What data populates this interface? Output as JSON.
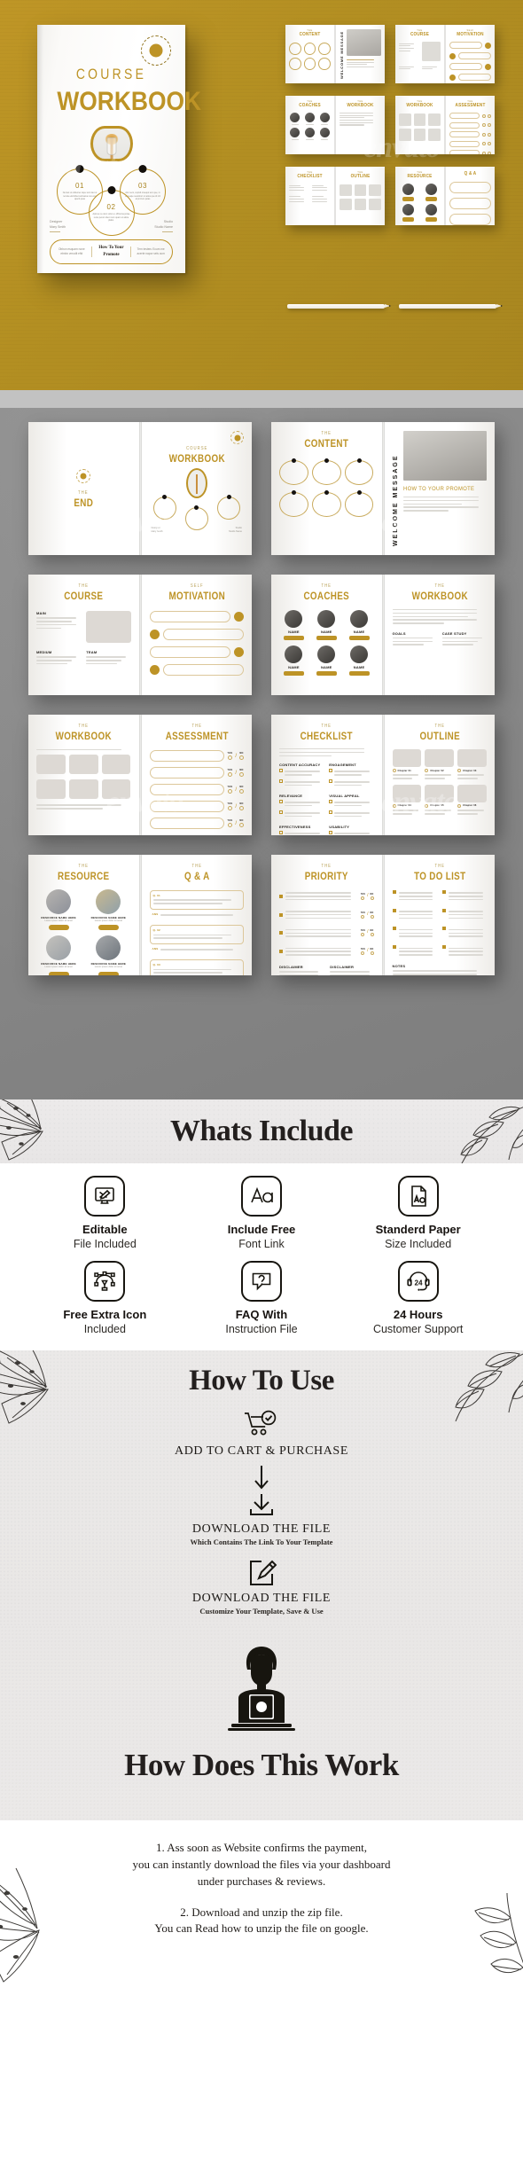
{
  "hero": {
    "cover": {
      "badge_icon": "seal-badge-icon",
      "eyebrow": "COURSE",
      "title": "WORKBOOK",
      "circles": [
        {
          "num": "01",
          "text": "Ne laut ut odituores rape sum laut ut remote elicinibet subnama non-sinc aperit quas"
        },
        {
          "num": "02",
          "text": "Apid es ce dem solut et, officuma porae recte perum ident cum quam ut adice plabo."
        },
        {
          "num": "03",
          "text": "Atur sent, cupistl onsequi tem que, in Aeceape nessitrum ut atius que id mil at prorum quias"
        }
      ],
      "meta_left_label": "Designer",
      "meta_left_value": "Mary Smith",
      "meta_right_label": "Studio",
      "meta_right_value": "Studio Name",
      "bar_left": "Obbon esquam none etmbx vmodit efid",
      "bar_mid": "How To Your Promote",
      "bar_right": "Tem testeru Ecum me acerte napor sels cum"
    },
    "watermark": "envato",
    "thumbnails": [
      {
        "left_sup": "THE",
        "left_title": "CONTENT",
        "right_sup": "",
        "right_title": "WELCOME MESSAGE",
        "kind": "content"
      },
      {
        "left_sup": "THE",
        "left_title": "COURSE",
        "right_sup": "SELF",
        "right_title": "MOTIVATION",
        "kind": "course"
      },
      {
        "left_sup": "THE",
        "left_title": "COACHES",
        "right_sup": "THE",
        "right_title": "WORKBOOK",
        "kind": "coaches"
      },
      {
        "left_sup": "THE",
        "left_title": "WORKBOOK",
        "right_sup": "THE",
        "right_title": "ASSESSMENT",
        "kind": "workbook"
      },
      {
        "left_sup": "THE",
        "left_title": "CHECKLIST",
        "right_sup": "THE",
        "right_title": "OUTLINE",
        "kind": "checklist"
      },
      {
        "left_sup": "THE",
        "left_title": "RESOURCE",
        "right_sup": "",
        "right_title": "Q & A",
        "kind": "resource"
      }
    ],
    "pencil_icon": "pencil-icon"
  },
  "spreads": [
    {
      "left_sup": "THE",
      "left_title": "END",
      "right_sup": "COURSE",
      "right_title": "WORKBOOK",
      "kind": "end-cover"
    },
    {
      "left_sup": "THE",
      "left_title": "CONTENT",
      "right_sup": "",
      "right_title": "WELCOME MESSAGE",
      "right_sub": "HOW TO YOUR PROMOTE",
      "kind": "content"
    },
    {
      "left_sup": "THE",
      "left_title": "COURSE",
      "right_sup": "SELF",
      "right_title": "MOTIVATION",
      "kind": "course"
    },
    {
      "left_sup": "THE",
      "left_title": "COACHES",
      "right_sup": "THE",
      "right_title": "WORKBOOK",
      "kind": "coaches"
    },
    {
      "left_sup": "THE",
      "left_title": "WORKBOOK",
      "right_sup": "THE",
      "right_title": "ASSESSMENT",
      "kind": "workbook"
    },
    {
      "left_sup": "THE",
      "left_title": "CHECKLIST",
      "right_sup": "THE",
      "right_title": "OUTLINE",
      "kind": "checklist"
    },
    {
      "left_sup": "THE",
      "left_title": "RESOURCE",
      "right_sup": "THE",
      "right_title": "Q & A",
      "kind": "resource"
    },
    {
      "left_sup": "THE",
      "left_title": "PRIORITY",
      "right_sup": "THE",
      "right_title": "TO DO LIST",
      "kind": "priority"
    }
  ],
  "checklist_labels": {
    "a": "CONTENT ACCURACY",
    "b": "ENGAGEMENT",
    "c": "RELEVANCE",
    "d": "VISUAL APPEAL",
    "e": "EFFECTIVENESS",
    "f": "USABILITY"
  },
  "priority_labels": {
    "disclaimer": "DISCLAIMER",
    "notes": "NOTES"
  },
  "assessment_answer": {
    "yes": "YES",
    "no": "NO"
  },
  "whats_include": {
    "heading": "Whats Include",
    "floral_left_icon": "lily-flower-icon",
    "floral_right_icon": "leaf-branch-icon",
    "features": [
      {
        "icon": "monitor-pencil-icon",
        "line1": "Editable",
        "line2": "File Included"
      },
      {
        "icon": "font-aa-icon",
        "line1": "Include Free",
        "line2": "Font Link"
      },
      {
        "icon": "paper-a0-icon",
        "line1": "Standerd Paper",
        "line2": "Size Included"
      },
      {
        "icon": "pen-tool-icon",
        "line1": "Free Extra Icon",
        "line2": "Included"
      },
      {
        "icon": "faq-bubble-icon",
        "line1": "FAQ With",
        "line2": "Instruction File"
      },
      {
        "icon": "headset-24-icon",
        "line1": "24 Hours",
        "line2": "Customer Support"
      }
    ]
  },
  "how_to_use": {
    "heading": "How To Use",
    "steps": [
      {
        "icon": "cart-check-icon",
        "title": "ADD TO CART & PURCHASE",
        "subtitle": ""
      },
      {
        "icon": "download-icon",
        "title": "DOWNLOAD THE FILE",
        "subtitle": "Which Contains The Link To Your Template"
      },
      {
        "icon": "edit-square-icon",
        "title": "DOWNLOAD THE FILE",
        "subtitle": "Customize Your Template, Save & Use"
      }
    ],
    "arrow_icon": "down-arrow-icon"
  },
  "how_does_this_work": {
    "icon": "person-laptop-icon",
    "heading": "How Does This Work",
    "paragraph_1_line_1": "1. Ass soon as Website confirms the payment,",
    "paragraph_1_line_2": "you can instantly download the files via your dashboard",
    "paragraph_1_line_3": "under purchases & reviews.",
    "paragraph_2_line_1": "2. Download and unzip the zip file.",
    "paragraph_2_line_2": "You can Read how to unzip the file on google."
  },
  "colors": {
    "gold": "#bd9326",
    "hero_bg": "#b38f22",
    "grey_bg": "#888888",
    "ink": "#231f1e",
    "paper": "#ebe9e8"
  }
}
